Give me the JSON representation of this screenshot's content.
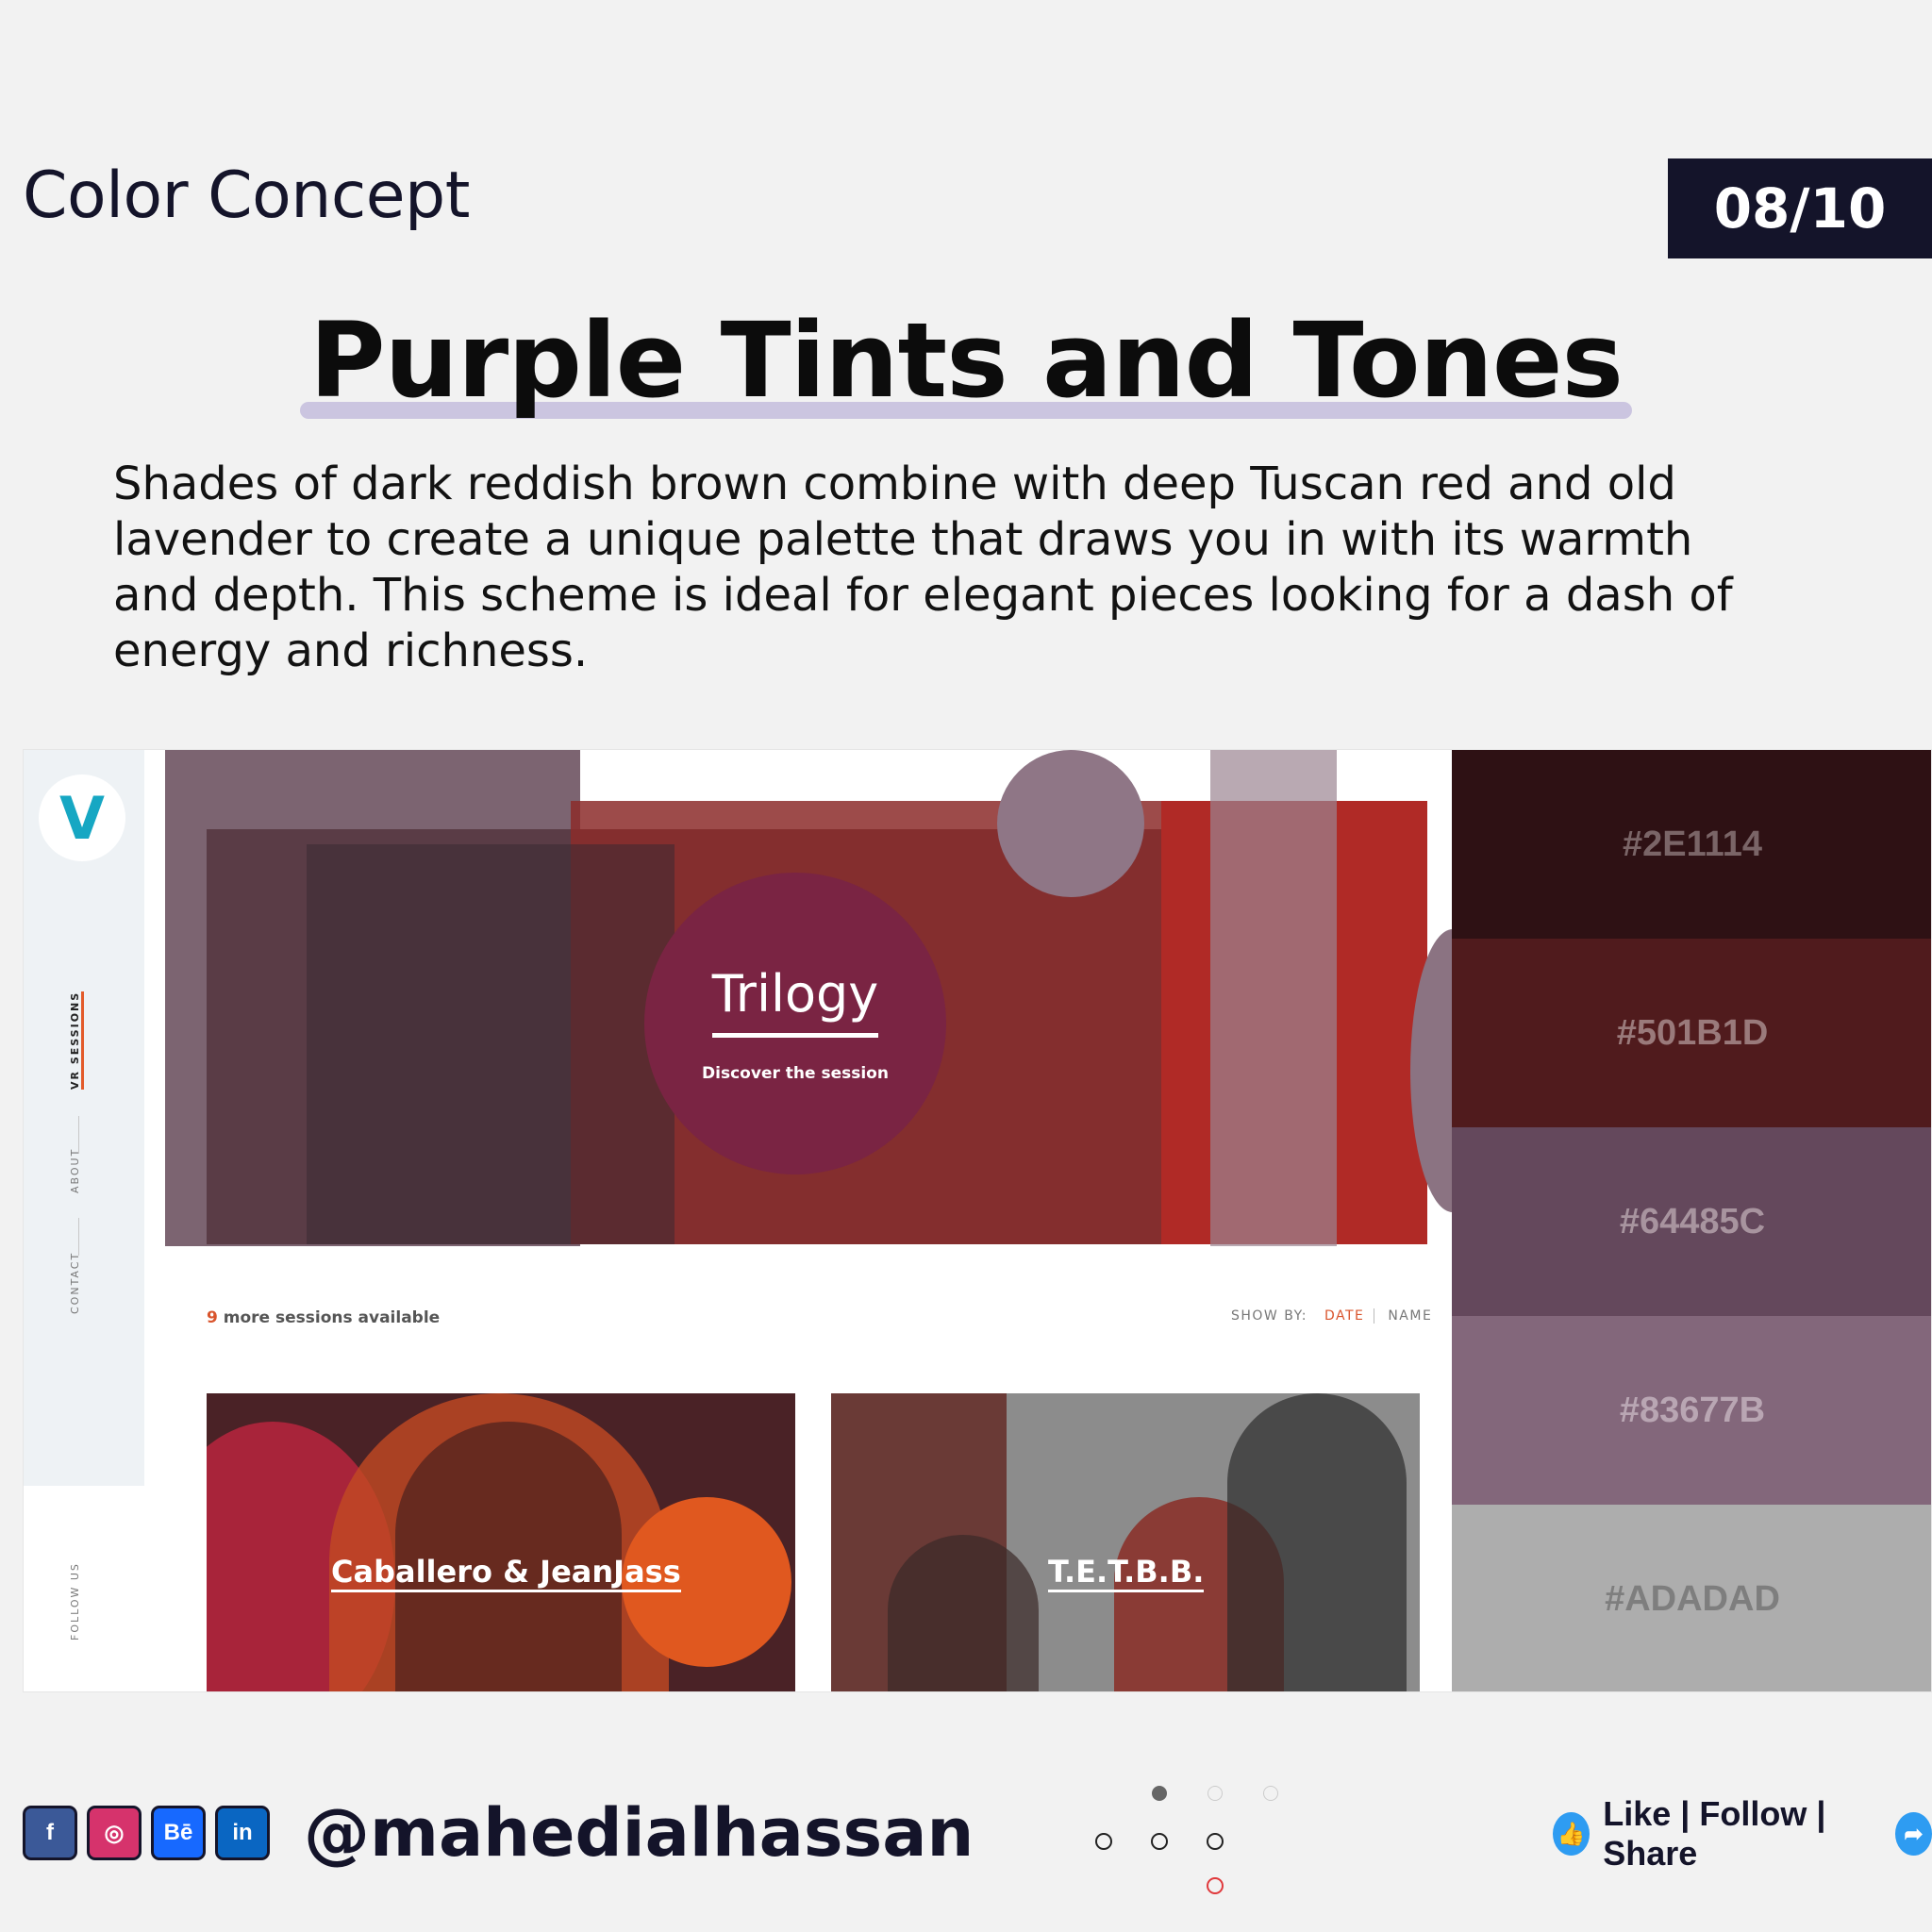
{
  "header": {
    "series_label": "Color Concept",
    "page_counter": "08/10"
  },
  "headline": "Purple Tints and Tones",
  "description": "Shades of dark reddish brown combine with deep Tuscan red and old lavender to create a unique palette that draws you in with its warmth and depth. This scheme is ideal for elegant pieces looking for a dash of energy and richness.",
  "mockup": {
    "logo_letter": "V",
    "nav": [
      "VR SESSIONS",
      "ABOUT",
      "CONTACT",
      "FOLLOW US"
    ],
    "hero_title": "Trilogy",
    "hero_subtitle": "Discover the session",
    "sessions_count": "9",
    "sessions_text": "more sessions available",
    "show_by_label": "SHOW BY:",
    "sort_options": [
      "DATE",
      "NAME"
    ],
    "cards": [
      "Caballero & JeanJass",
      "T.E.T.B.B."
    ]
  },
  "palette": [
    {
      "hex": "#2E1114",
      "color": "#2e1114",
      "text_color": "#7a6567"
    },
    {
      "hex": "#501B1D",
      "color": "#501b1d",
      "text_color": "#9a7a7b"
    },
    {
      "hex": "#64485C",
      "color": "#64485c",
      "text_color": "#a8949f"
    },
    {
      "hex": "#83677B",
      "color": "#83677b",
      "text_color": "#b9a6b3"
    },
    {
      "hex": "#ADADAD",
      "color": "#adadad",
      "text_color": "#7e7e7e"
    }
  ],
  "footer": {
    "social": [
      {
        "icon": "facebook-icon",
        "label": "f",
        "color": "#3b5998"
      },
      {
        "icon": "instagram-icon",
        "label": "◎",
        "color": "#d6336c"
      },
      {
        "icon": "behance-icon",
        "label": "Bē",
        "color": "#1769ff"
      },
      {
        "icon": "linkedin-icon",
        "label": "in",
        "color": "#0a66c2"
      }
    ],
    "handle": "@mahedialhassan",
    "cta": "Like | Follow | Share"
  }
}
